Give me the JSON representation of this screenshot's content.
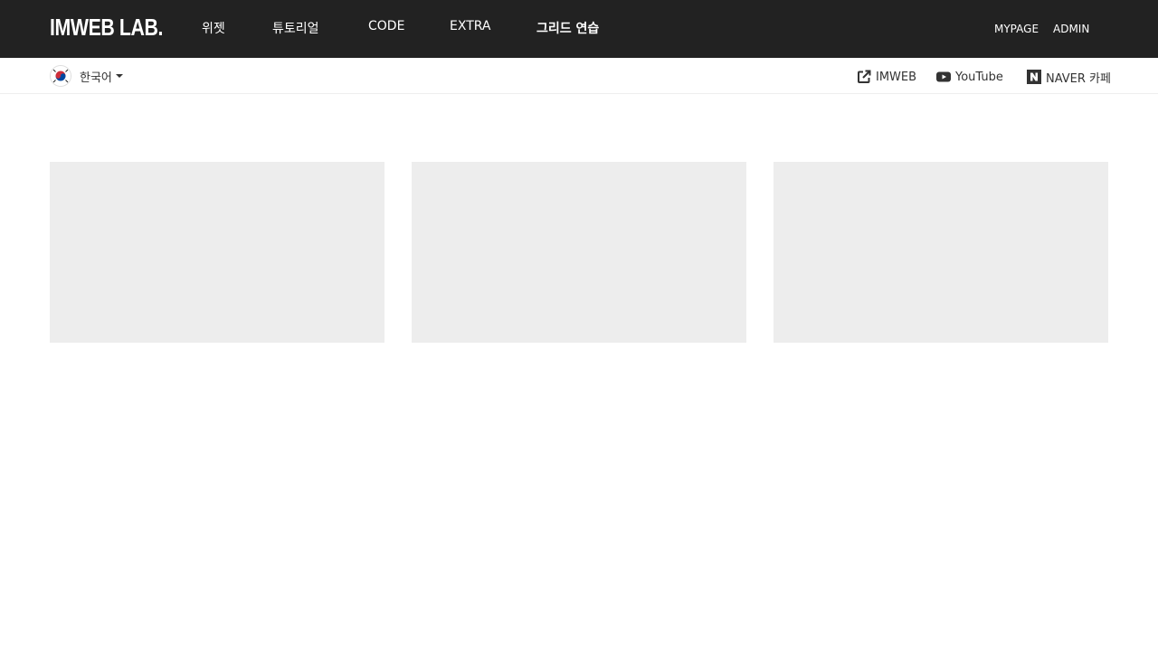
{
  "header": {
    "logo": "IMWEB LAB.",
    "nav": [
      {
        "label": "위젯"
      },
      {
        "label": "튜토리얼"
      },
      {
        "label": "CODE"
      },
      {
        "label": "EXTRA"
      },
      {
        "label": "그리드 연습"
      }
    ],
    "active_nav": "그리드 연습",
    "util_links": [
      {
        "label": "MYPAGE"
      },
      {
        "label": "ADMIN"
      }
    ]
  },
  "subbar": {
    "language": {
      "label": "한국어",
      "icon": "korea-flag-icon"
    },
    "links": [
      {
        "label": "IMWEB",
        "icon": "external-link-icon"
      },
      {
        "label": "YouTube",
        "icon": "youtube-icon"
      },
      {
        "label": "NAVER 카페",
        "icon": "naver-icon"
      }
    ]
  },
  "colors": {
    "header_bg": "#222222",
    "card_bg": "#ededed",
    "text_dark": "#333333"
  }
}
